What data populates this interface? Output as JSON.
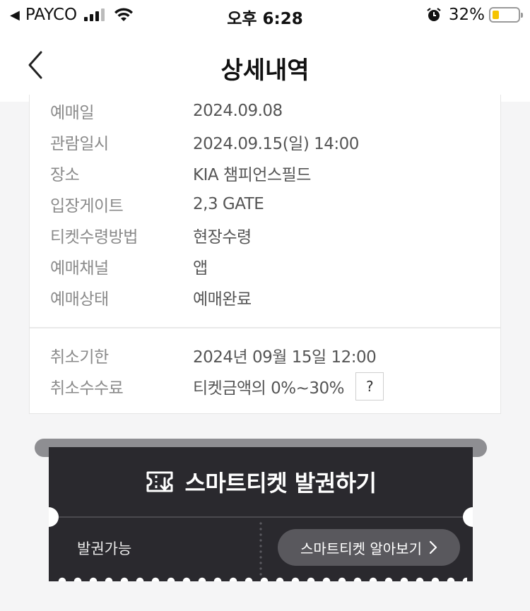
{
  "status_bar": {
    "carrier": "PAYCO",
    "time": "오후 6:28",
    "battery": "32%",
    "battery_level": 0.32,
    "battery_color": "#f5c400"
  },
  "header": {
    "title": "상세내역",
    "back_icon": "chevron-left-icon"
  },
  "details": [
    {
      "label": "예매일",
      "value": "2024.09.08"
    },
    {
      "label": "관람일시",
      "value": "2024.09.15(일) 14:00"
    },
    {
      "label": "장소",
      "value": "KIA 챔피언스필드"
    },
    {
      "label": "입장게이트",
      "value": "2,3 GATE"
    },
    {
      "label": "티켓수령방법",
      "value": "현장수령"
    },
    {
      "label": "예매채널",
      "value": "앱"
    },
    {
      "label": "예매상태",
      "value": "예매완료"
    }
  ],
  "cancellation": {
    "deadline_label": "취소기한",
    "deadline_value": "2024년 09월 15일 12:00",
    "fee_label": "취소수수료",
    "fee_value": "티켓금액의 0%~30%",
    "help_label": "?"
  },
  "smart_ticket": {
    "issue_label": "스마트티켓 발권하기",
    "status": "발권가능",
    "learn_more_label": "스마트티켓 알아보기",
    "ticket_color": "#2a292e"
  }
}
